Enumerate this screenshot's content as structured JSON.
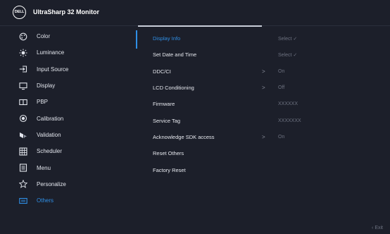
{
  "header": {
    "logo_text": "DELL",
    "title": "UltraSharp 32 Monitor"
  },
  "sidebar": {
    "items": [
      {
        "label": "Color",
        "icon": "color-icon"
      },
      {
        "label": "Luminance",
        "icon": "brightness-icon"
      },
      {
        "label": "Input Source",
        "icon": "input-source-icon"
      },
      {
        "label": "Display",
        "icon": "display-icon"
      },
      {
        "label": "PBP",
        "icon": "pbp-icon"
      },
      {
        "label": "Calibration",
        "icon": "calibration-icon"
      },
      {
        "label": "Validation",
        "icon": "validation-icon"
      },
      {
        "label": "Scheduler",
        "icon": "scheduler-icon"
      },
      {
        "label": "Menu",
        "icon": "menu-icon"
      },
      {
        "label": "Personalize",
        "icon": "star-icon"
      },
      {
        "label": "Others",
        "icon": "others-icon",
        "active": true
      }
    ]
  },
  "content": {
    "rows": [
      {
        "label": "Display Info",
        "value": "Select ✓",
        "active": true
      },
      {
        "label": "Set Date and Time",
        "value": "Select ✓"
      },
      {
        "label": "DDC/CI",
        "arrow": ">",
        "value": "On"
      },
      {
        "label": "LCD Conditioning",
        "arrow": ">",
        "value": "Off"
      },
      {
        "label": "Firmware",
        "value": "XXXXXX"
      },
      {
        "label": "Service Tag",
        "value": "XXXXXXX"
      },
      {
        "label": "Acknowledge SDK access",
        "arrow": ">",
        "value": "On"
      },
      {
        "label": "Reset Others"
      },
      {
        "label": "Factory Reset"
      }
    ]
  },
  "footer": {
    "exit_label": "‹  Exit"
  },
  "colors": {
    "background": "#1c1f2a",
    "accent": "#2f8fe6",
    "text": "#e6e8ee",
    "muted": "#6d7280"
  }
}
